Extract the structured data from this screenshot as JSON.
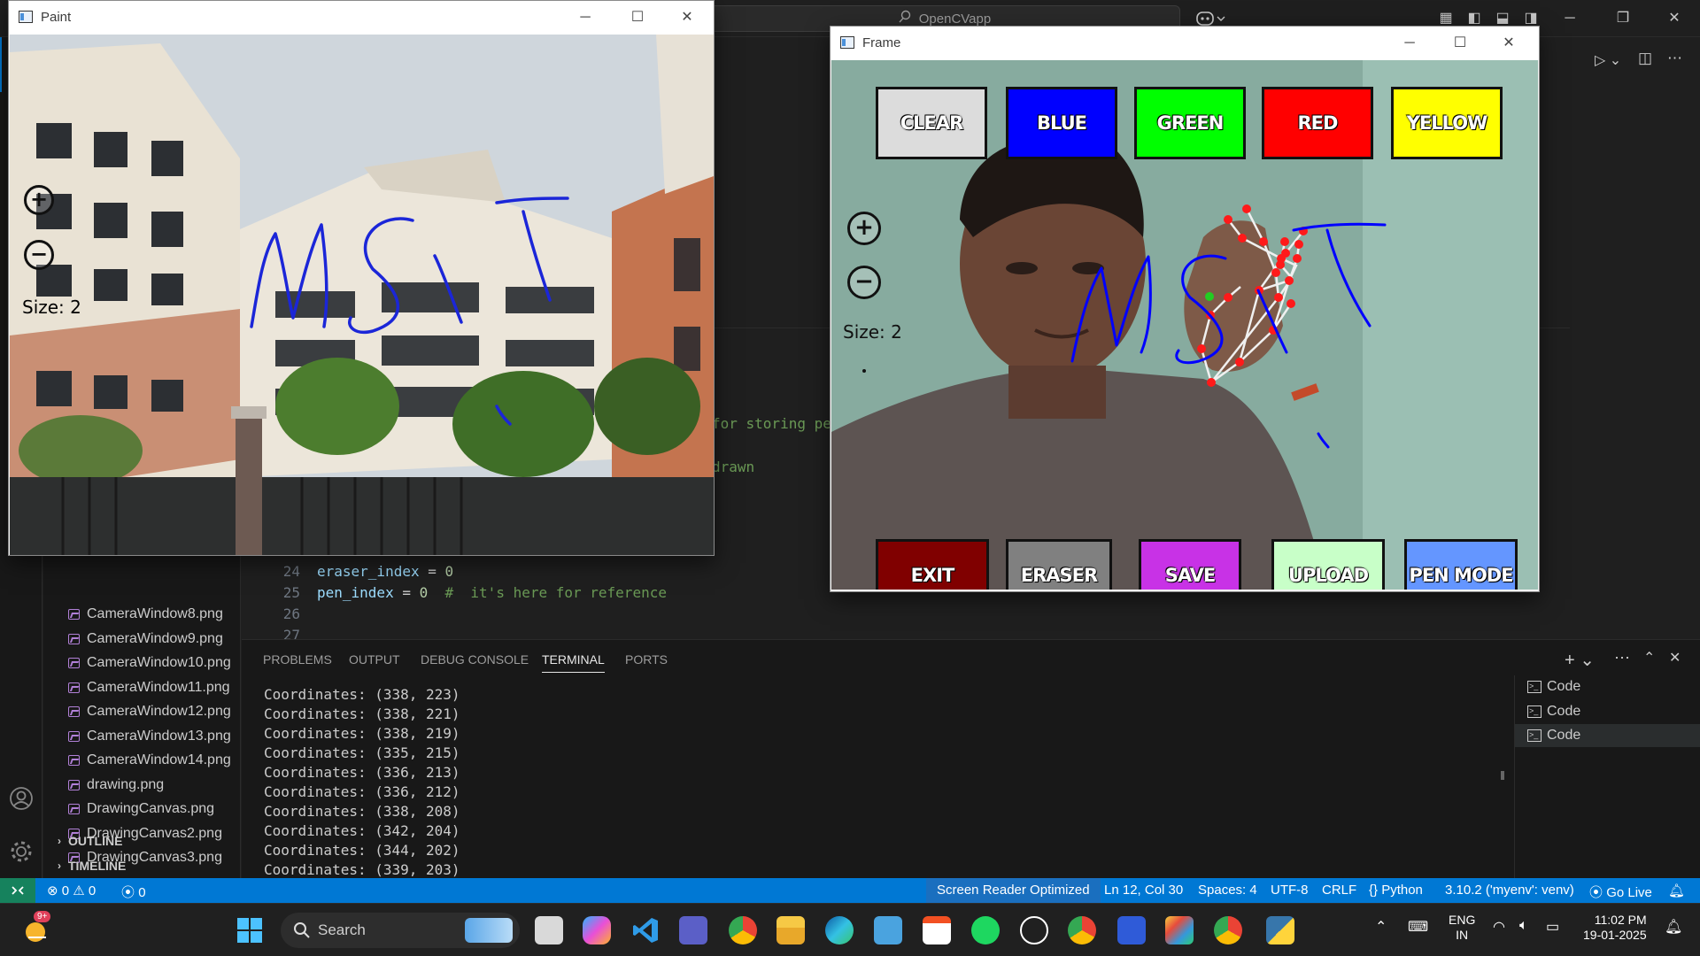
{
  "vscode": {
    "command_center": "OpenCVapp",
    "explorer": {
      "files": [
        "CameraWindow8.png",
        "CameraWindow9.png",
        "CameraWindow10.png",
        "CameraWindow11.png",
        "CameraWindow12.png",
        "CameraWindow13.png",
        "CameraWindow14.png",
        "drawing.png",
        "DrawingCanvas.png",
        "DrawingCanvas2.png",
        "DrawingCanvas3.png"
      ],
      "outline": "OUTLINE",
      "timeline": "TIMELINE"
    },
    "editor": {
      "partial_comment_1": "for storing pe",
      "partial_comment_2": "drawn",
      "lines": [
        {
          "num": "24",
          "var": "eraser_index",
          "op": " = ",
          "val": "0",
          "comment": ""
        },
        {
          "num": "25",
          "var": "pen_index",
          "op": " = ",
          "val": "0",
          "comment": "  #  it's here for reference"
        },
        {
          "num": "26",
          "var": "",
          "op": "",
          "val": "",
          "comment": ""
        },
        {
          "num": "27",
          "var": "",
          "op": "",
          "val": "",
          "comment": ""
        }
      ]
    },
    "panel": {
      "tabs": [
        "PROBLEMS",
        "OUTPUT",
        "DEBUG CONSOLE",
        "TERMINAL",
        "PORTS"
      ],
      "active_tab": "TERMINAL",
      "terminal_lines": [
        "Coordinates: (338, 223)",
        "Coordinates: (338, 221)",
        "Coordinates: (338, 219)",
        "Coordinates: (335, 215)",
        "Coordinates: (336, 213)",
        "Coordinates: (336, 212)",
        "Coordinates: (338, 208)",
        "Coordinates: (342, 204)",
        "Coordinates: (344, 202)",
        "Coordinates: (339, 203)"
      ],
      "terminals": [
        "Code",
        "Code",
        "Code"
      ]
    },
    "status_bar": {
      "errors": "0",
      "warnings": "0",
      "ports": "0",
      "screen_reader": "Screen Reader Optimized",
      "cursor": "Ln 12, Col 30",
      "spaces": "Spaces: 4",
      "encoding": "UTF-8",
      "eol": "CRLF",
      "language": "Python",
      "interpreter": "3.10.2 ('myenv': venv)",
      "go_live": "Go Live"
    }
  },
  "paint_window": {
    "title": "Paint",
    "size_label": "Size: 2"
  },
  "frame_window": {
    "title": "Frame",
    "top_buttons": [
      {
        "label": "CLEAR",
        "color": "#dcdcdc"
      },
      {
        "label": "BLUE",
        "color": "#0000ff"
      },
      {
        "label": "GREEN",
        "color": "#00ff00"
      },
      {
        "label": "RED",
        "color": "#ff0000"
      },
      {
        "label": "YELLOW",
        "color": "#ffff00"
      }
    ],
    "bottom_buttons": [
      {
        "label": "EXIT",
        "color": "#800000"
      },
      {
        "label": "ERASER",
        "color": "#808080"
      },
      {
        "label": "SAVE",
        "color": "#c832e6"
      },
      {
        "label": "UPLOAD",
        "color": "#c8ffc8"
      },
      {
        "label": "PEN MODE",
        "color": "#6496ff"
      }
    ],
    "size_label": "Size: 2",
    "drawing_text": "MSIT",
    "pen_color": "#0000ff"
  },
  "taskbar": {
    "search_label": "Search",
    "notification_badge": "9+",
    "language": "ENG",
    "region": "IN",
    "time": "11:02 PM",
    "date": "19-01-2025"
  }
}
